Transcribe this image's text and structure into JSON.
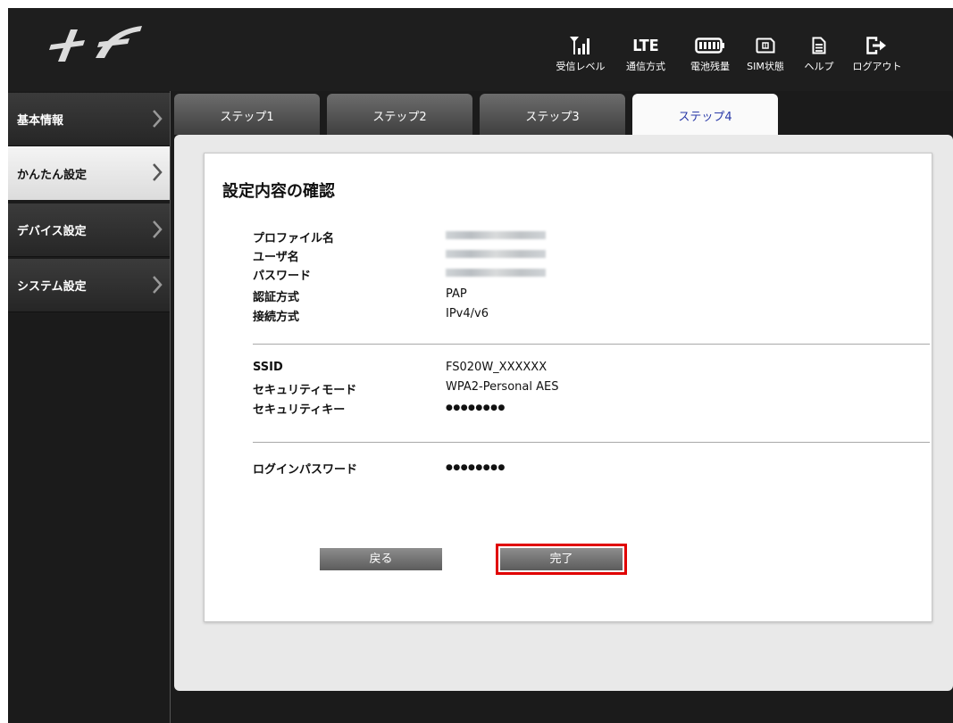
{
  "header": {
    "icons": [
      {
        "name": "signal-icon",
        "label": "受信レベル"
      },
      {
        "name": "lte-icon",
        "label": "通信方式",
        "glyph_text": "LTE"
      },
      {
        "name": "battery-icon",
        "label": "電池残量"
      },
      {
        "name": "sim-icon",
        "label": "SIM状態"
      },
      {
        "name": "help-icon",
        "label": "ヘルプ"
      },
      {
        "name": "logout-icon",
        "label": "ログアウト"
      }
    ]
  },
  "sidebar": {
    "items": [
      {
        "label": "基本情報"
      },
      {
        "label": "かんたん設定",
        "active": true
      },
      {
        "label": "デバイス設定"
      },
      {
        "label": "システム設定"
      }
    ]
  },
  "tabs": [
    {
      "label": "ステップ1"
    },
    {
      "label": "ステップ2"
    },
    {
      "label": "ステップ3"
    },
    {
      "label": "ステップ4",
      "active": true
    }
  ],
  "card": {
    "title": "設定内容の確認",
    "profile": [
      {
        "label": "プロファイル名",
        "value": ""
      },
      {
        "label": "ユーザ名",
        "value": ""
      },
      {
        "label": "パスワード",
        "value": ""
      },
      {
        "label": "認証方式",
        "value": "PAP"
      },
      {
        "label": "接続方式",
        "value": "IPv4/v6"
      }
    ],
    "wifi": [
      {
        "label": "SSID",
        "value": "FS020W_XXXXXX"
      },
      {
        "label": "セキュリティモード",
        "value": "WPA2-Personal AES"
      },
      {
        "label": "セキュリティキー",
        "value": "●●●●●●●●"
      }
    ],
    "login": {
      "label": "ログインパスワード",
      "value": "●●●●●●●●"
    },
    "buttons": {
      "back": "戻る",
      "done": "完了"
    }
  },
  "colors": {
    "accent": "#2a3aa8",
    "highlight": "#e00000",
    "background": "#1b1b1b"
  }
}
